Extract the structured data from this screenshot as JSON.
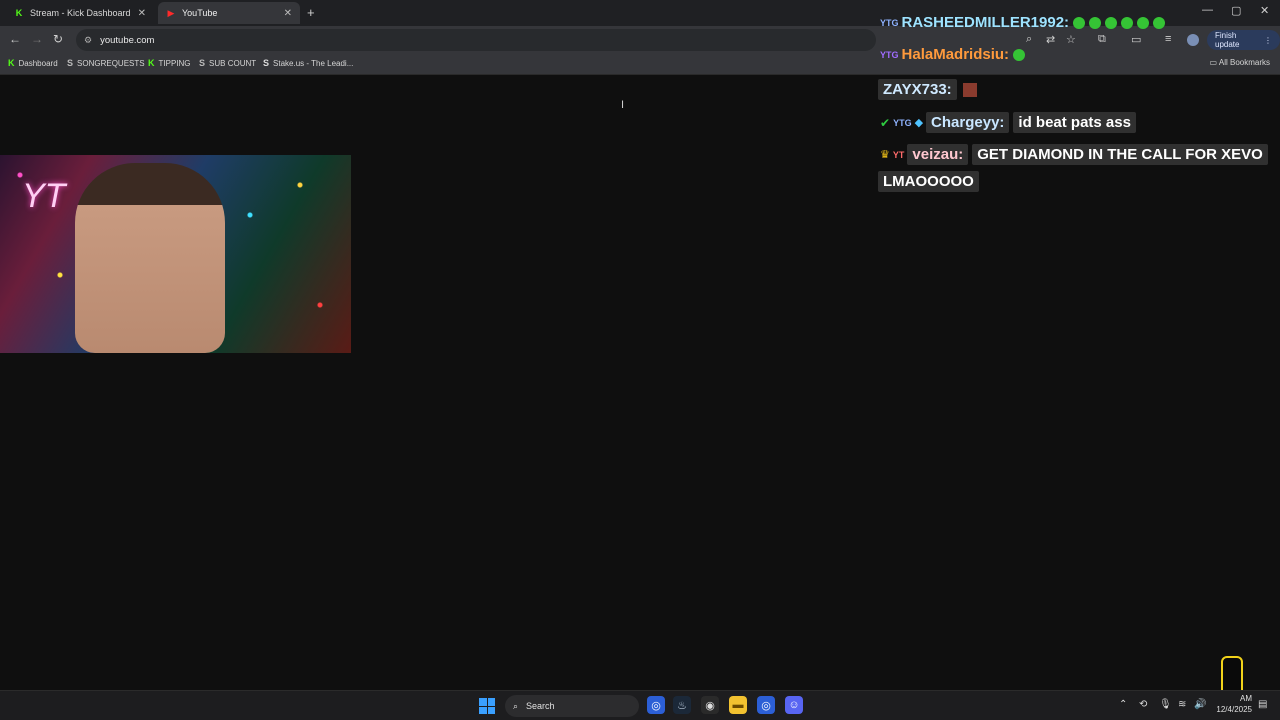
{
  "browser": {
    "tabs": [
      {
        "title": "Stream - Kick Dashboard",
        "favicon": "K"
      },
      {
        "title": "YouTube",
        "favicon": "▶"
      }
    ],
    "new_tab_symbol": "+",
    "window_controls": {
      "minimize": "—",
      "maximize": "▢",
      "close": "✕"
    },
    "address": "youtube.com",
    "finish_update": "Finish update",
    "bookmarks": [
      {
        "label": "Dashboard",
        "icon": "K"
      },
      {
        "label": "SONGREQUESTS",
        "icon": "S"
      },
      {
        "label": "TIPPING",
        "icon": "K"
      },
      {
        "label": "SUB COUNT",
        "icon": "S"
      },
      {
        "label": "Stake.us - The Leadi...",
        "icon": "S"
      }
    ],
    "all_bookmarks": "All Bookmarks"
  },
  "chat": [
    {
      "user": "RASHEEDMILLER1992:",
      "badge": "YTG",
      "text": "",
      "emotes": 6,
      "color": "#9ee3ff"
    },
    {
      "user": "HalaMadridsiu:",
      "badge": "YTG",
      "text": "",
      "emotes": 1,
      "color": "#ff9a3c"
    },
    {
      "user": "ZAYX733:",
      "badge": "",
      "text": "",
      "emotes": 0,
      "color": "#cfe9ff"
    },
    {
      "user": "Chargeyy:",
      "badge": "YTG",
      "text": "id beat pats ass",
      "emotes": 0,
      "color": "#c9e6ff"
    },
    {
      "user": "veizau:",
      "badge": "YT",
      "text": "GET DIAMOND IN THE CALL FOR XEVO",
      "emotes": 0,
      "color": "#ffc8d0"
    },
    {
      "user": "",
      "badge": "",
      "text": "LMAOOOOO",
      "emotes": 0,
      "color": "#ffffff"
    }
  ],
  "taskbar": {
    "search_label": "Search",
    "clock_time": "AM",
    "clock_date": "12/4/2025"
  },
  "webcam": {
    "neon_text": "YT"
  }
}
